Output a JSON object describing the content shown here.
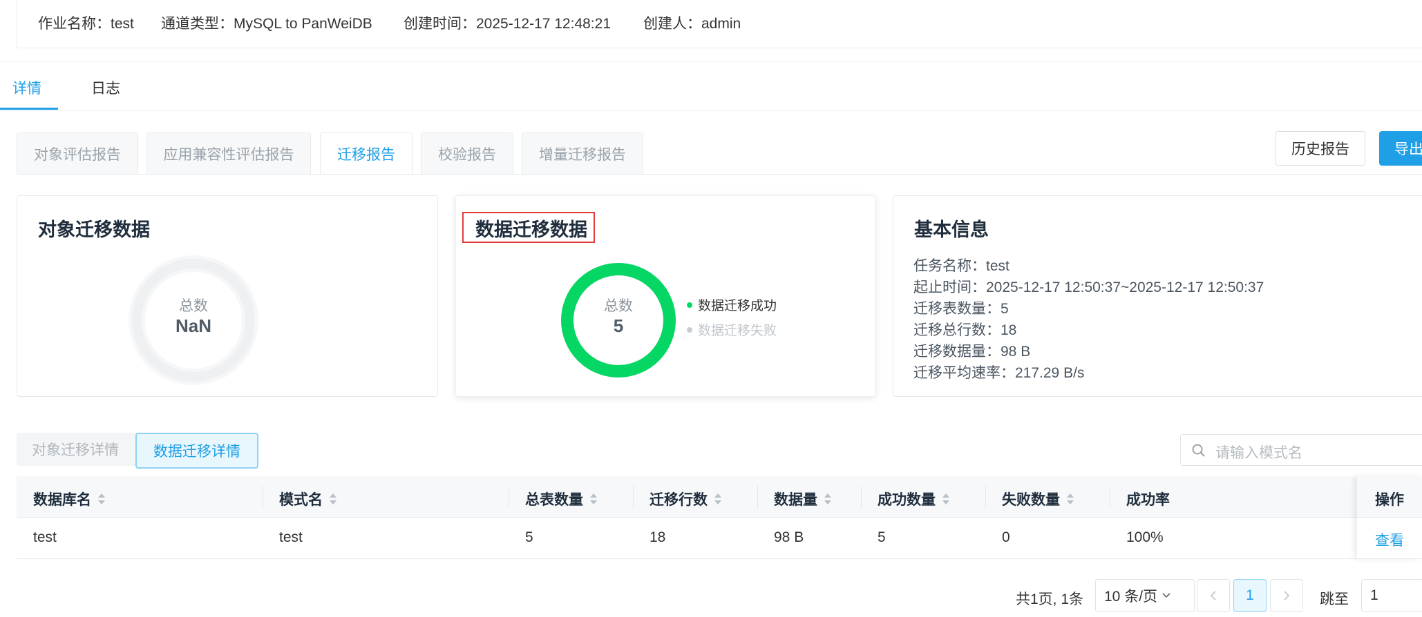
{
  "header": {
    "job_name": "作业名称：test",
    "channel_type": "通道类型：MySQL to PanWeiDB",
    "created_time": "创建时间：2025-12-17 12:48:21",
    "creator": "创建人：admin"
  },
  "main_tabs": [
    "详情",
    "日志"
  ],
  "report_tabs": [
    "对象评估报告",
    "应用兼容性评估报告",
    "迁移报告",
    "校验报告",
    "增量迁移报告"
  ],
  "buttons": {
    "history": "历史报告",
    "export": "导出"
  },
  "object_card": {
    "title": "对象迁移数据",
    "total_label": "总数",
    "total_value": "NaN"
  },
  "data_card": {
    "title": "数据迁移数据",
    "total_label": "总数",
    "total_value": "5",
    "legend": [
      {
        "label": "数据迁移成功",
        "color": "#06d664"
      },
      {
        "label": "数据迁移失败",
        "color": "#c8cdd1"
      }
    ],
    "success_fraction": 1.0
  },
  "basic_info": {
    "title": "基本信息",
    "lines": [
      "任务名称：test",
      "起止时间：2025-12-17 12:50:37~2025-12-17 12:50:37",
      "迁移表数量：5",
      "迁移总行数：18",
      "迁移数据量：98 B",
      "迁移平均速率：217.29 B/s"
    ]
  },
  "detail_toggles": [
    "对象迁移详情",
    "数据迁移详情"
  ],
  "search": {
    "placeholder": "请输入模式名"
  },
  "table": {
    "headers": [
      "数据库名",
      "模式名",
      "总表数量",
      "迁移行数",
      "数据量",
      "成功数量",
      "失败数量",
      "成功率",
      "操作"
    ],
    "rows": [
      [
        "test",
        "test",
        "5",
        "18",
        "98 B",
        "5",
        "0",
        "100%",
        "查看"
      ]
    ]
  },
  "pagination": {
    "summary": "共1页, 1条",
    "page_size": "10 条/页",
    "current_page": "1",
    "jump_label": "跳至",
    "jump_value": "1"
  },
  "colors": {
    "accent": "#1e9fe6",
    "success": "#06d664",
    "highlight": "#e23b3b"
  }
}
